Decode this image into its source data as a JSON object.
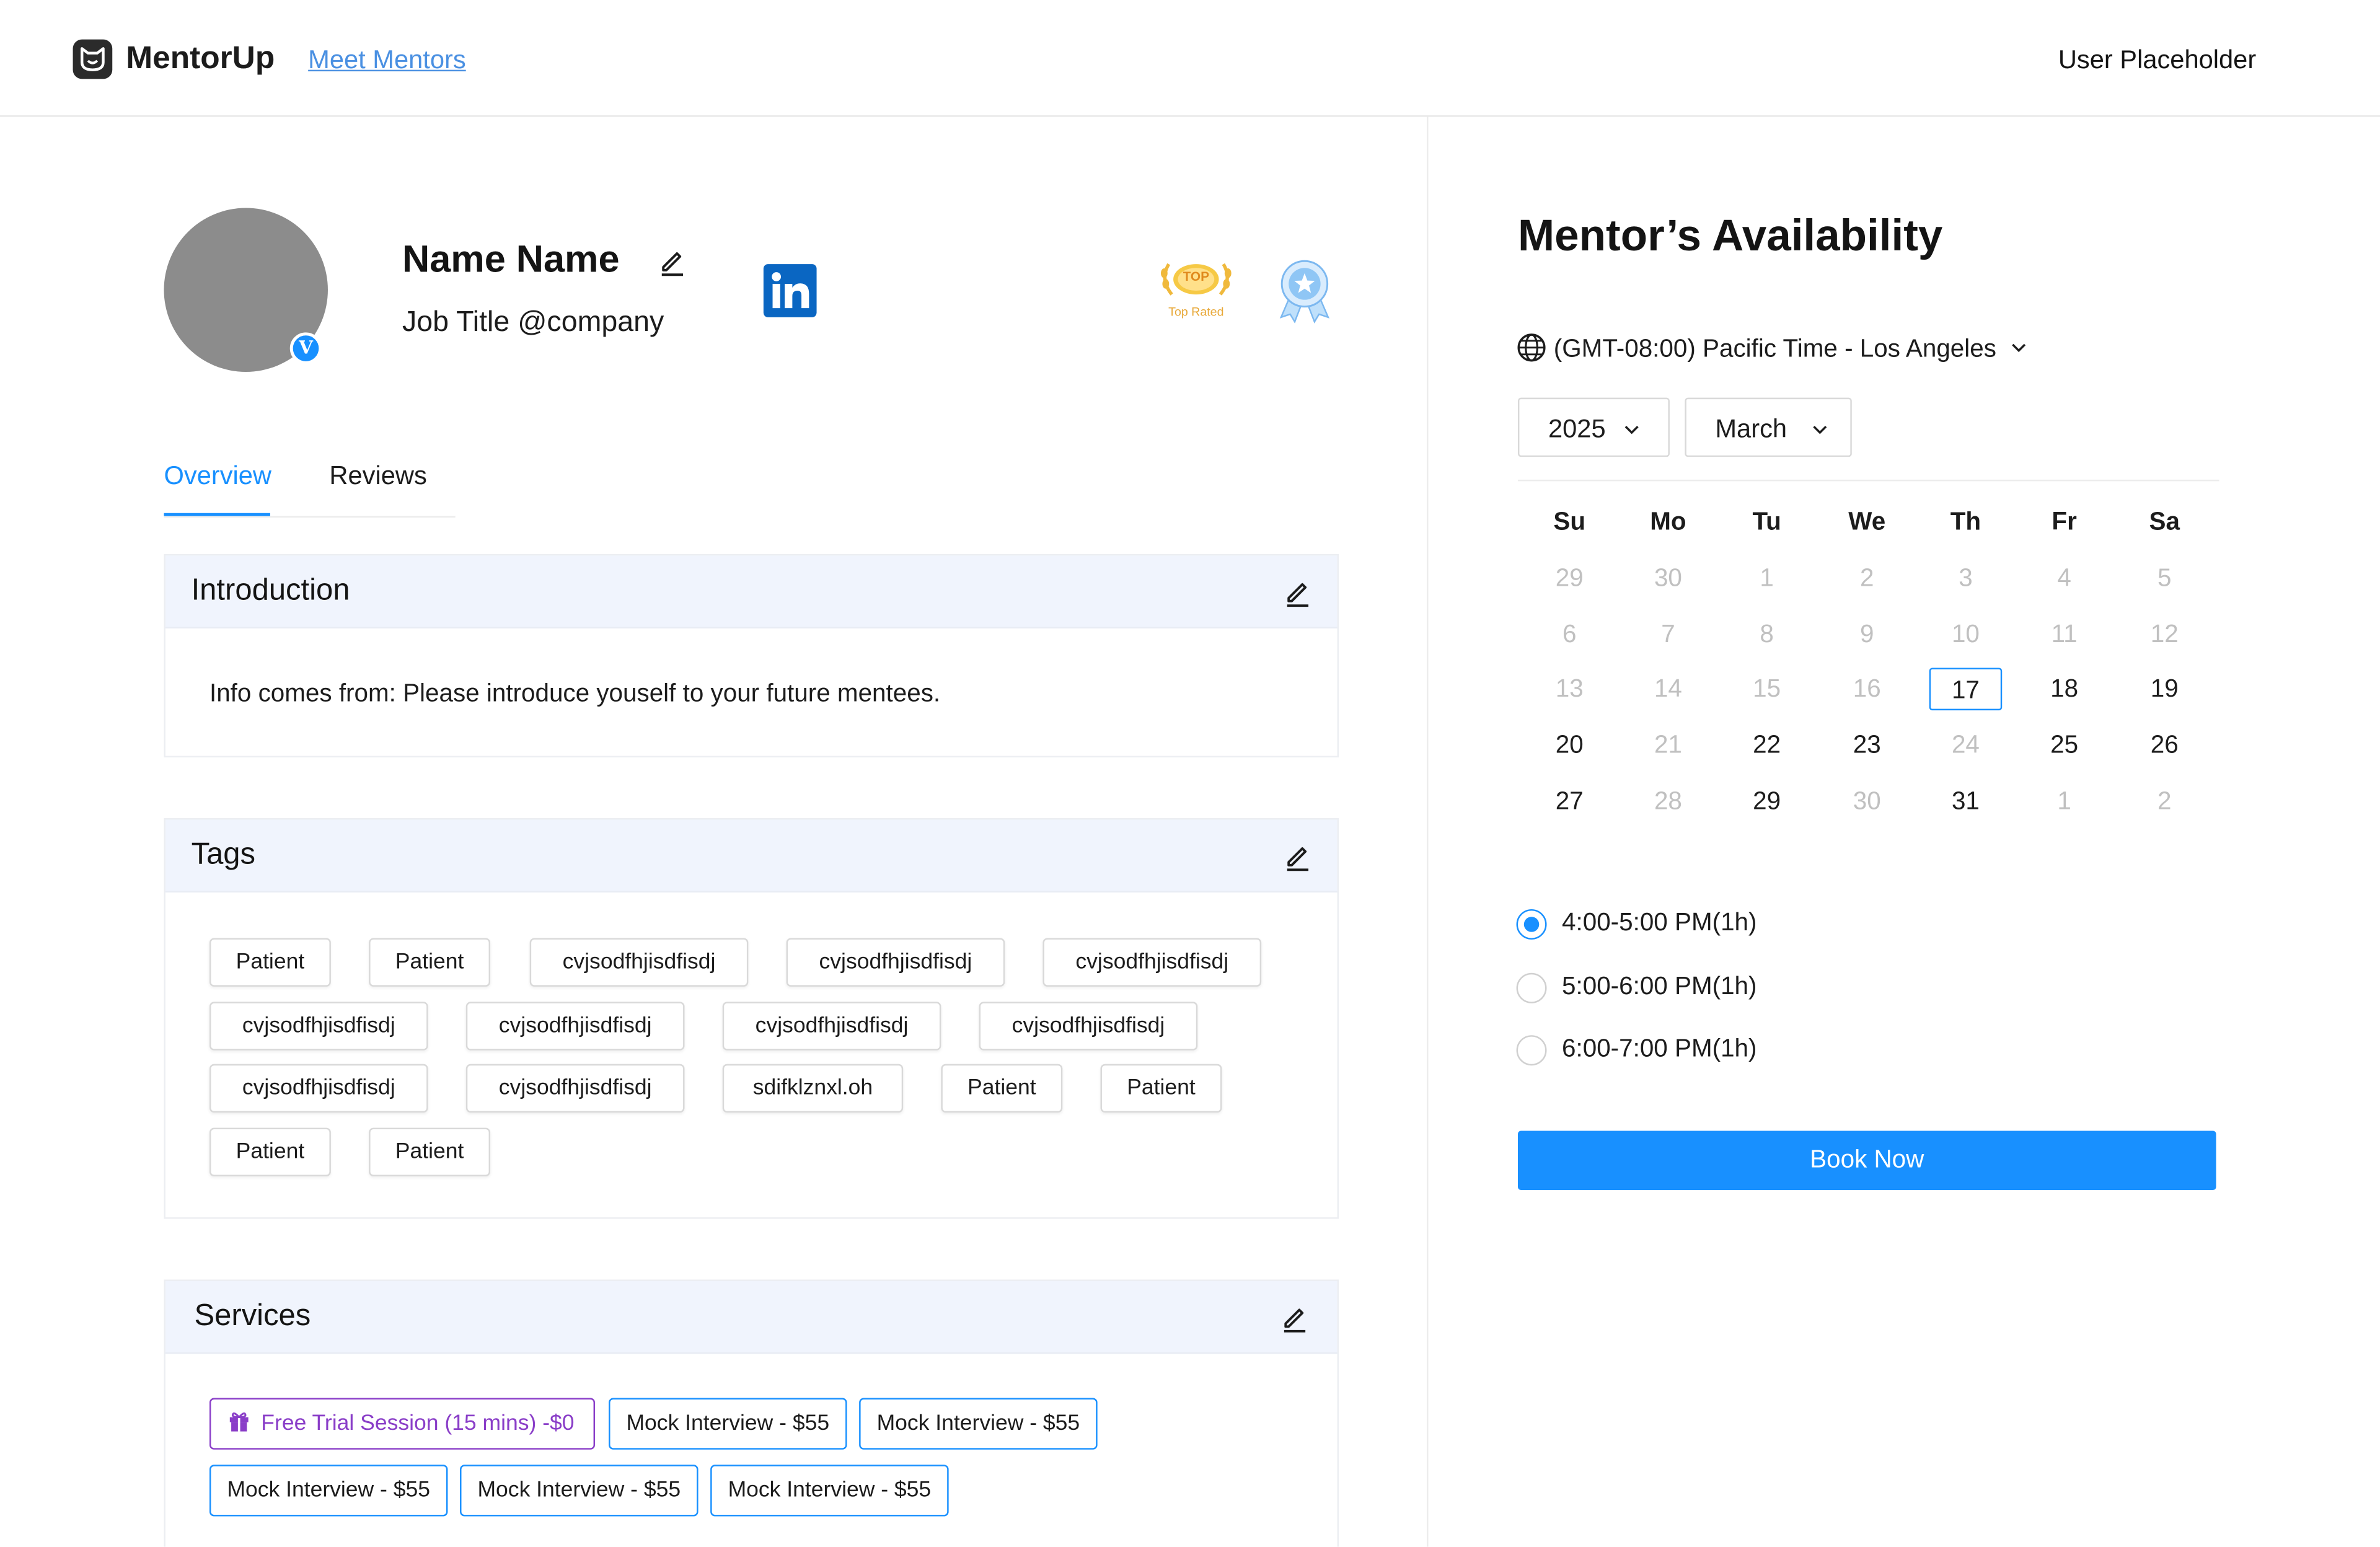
{
  "header": {
    "brand": "MentorUp",
    "nav_link": "Meet Mentors",
    "user": "User Placeholder"
  },
  "profile": {
    "name": "Name Name",
    "job_title": "Job Title @company",
    "verified_mark": "V",
    "top_badge_text": "TOP",
    "top_badge_caption": "Top Rated"
  },
  "tabs": [
    {
      "label": "Overview",
      "active": true
    },
    {
      "label": "Reviews",
      "active": false
    }
  ],
  "introduction": {
    "title": "Introduction",
    "text": "Info comes from: Please introduce youself to your future mentees."
  },
  "tags": {
    "title": "Tags",
    "items": [
      "Patient",
      "Patient",
      "cvjsodfhjisdfisdj",
      "cvjsodfhjisdfisdj",
      "cvjsodfhjisdfisdj",
      "cvjsodfhjisdfisdj",
      "cvjsodfhjisdfisdj",
      "cvjsodfhjisdfisdj",
      "cvjsodfhjisdfisdj",
      "cvjsodfhjisdfisdj",
      "cvjsodfhjisdfisdj",
      "sdifklznxl.oh",
      "Patient",
      "Patient",
      "Patient",
      "Patient"
    ]
  },
  "services": {
    "title": "Services",
    "items": [
      "Free Trial Session (15 mins)  -$0",
      "Mock Interview - $55",
      "Mock Interview - $55",
      "Mock Interview - $55",
      "Mock Interview - $55",
      "Mock Interview - $55"
    ]
  },
  "availability": {
    "title": "Mentor’s Availability",
    "timezone": "(GMT-08:00) Pacific Time - Los Angeles",
    "year": "2025",
    "month": "March",
    "weekdays": [
      "Su",
      "Mo",
      "Tu",
      "We",
      "Th",
      "Fr",
      "Sa"
    ],
    "weeks": [
      [
        "29",
        "30",
        "1",
        "2",
        "3",
        "4",
        "5"
      ],
      [
        "6",
        "7",
        "8",
        "9",
        "10",
        "11",
        "12"
      ],
      [
        "13",
        "14",
        "15",
        "16",
        "17",
        "18",
        "19"
      ],
      [
        "20",
        "21",
        "22",
        "23",
        "24",
        "25",
        "26"
      ],
      [
        "27",
        "28",
        "29",
        "30",
        "31",
        "1",
        "2"
      ]
    ],
    "selected_day": "17",
    "available_days": [
      "17",
      "18",
      "19",
      "20",
      "22",
      "23",
      "25",
      "26",
      "27",
      "29",
      "31"
    ],
    "time_slots": [
      {
        "label": "4:00-5:00 PM(1h)",
        "selected": true
      },
      {
        "label": "5:00-6:00 PM(1h)",
        "selected": false
      },
      {
        "label": "6:00-7:00 PM(1h)",
        "selected": false
      }
    ],
    "book_button": "Book Now"
  },
  "colors": {
    "accent": "#1890ff",
    "trial": "#8a3ec8",
    "linkedin": "#0a66c2",
    "card_header": "#f0f4fd"
  }
}
